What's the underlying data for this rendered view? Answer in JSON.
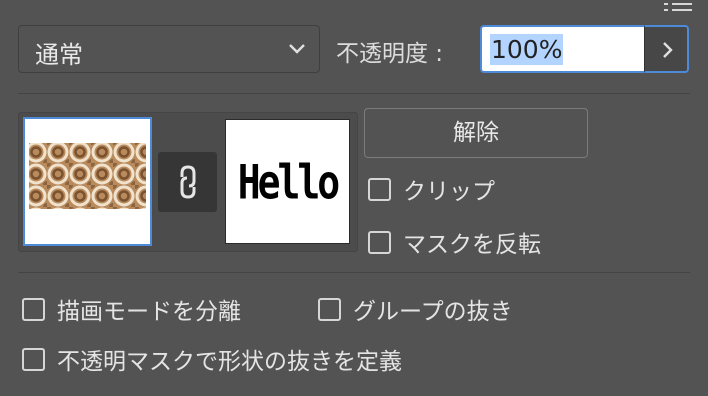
{
  "panel": {
    "blend_mode": "通常",
    "opacity_label": "不透明度 :",
    "opacity_value": "100%",
    "mask_text": "Hello",
    "release_label": "解除"
  },
  "options": {
    "clip": "クリップ",
    "invert_mask": "マスクを反転",
    "isolate_blending": "描画モードを分離",
    "knockout_group": "グループの抜き",
    "opacity_mask_knockout": "不透明マスクで形状の抜きを定義"
  },
  "icons": [
    "panel-menu-icon",
    "chevron-down-icon",
    "chevron-right-icon",
    "chain-link-icon"
  ],
  "colors": {
    "background": "#535353",
    "accent": "#4d8ad8",
    "selection": "#b3d4ff"
  }
}
